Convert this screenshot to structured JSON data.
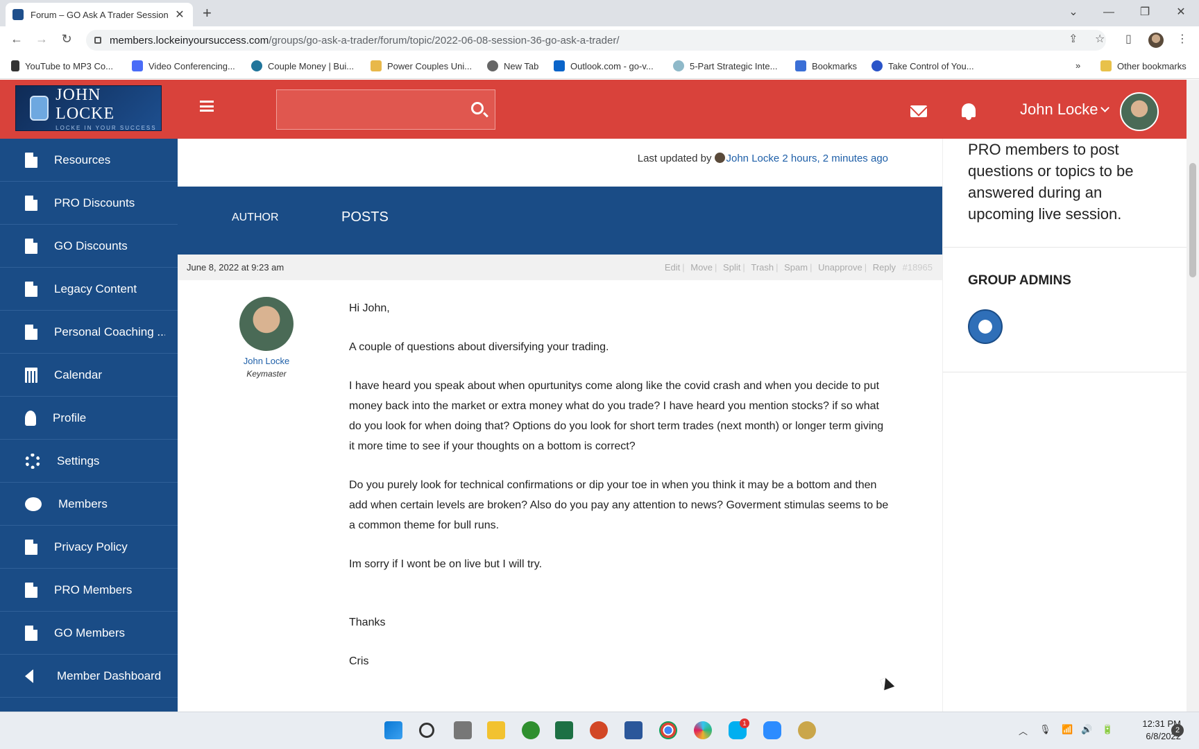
{
  "browser": {
    "tab_title": "Forum – GO Ask A Trader Session",
    "url_domain": "members.lockeinyoursuccess.com",
    "url_path": "/groups/go-ask-a-trader/forum/topic/2022-06-08-session-36-go-ask-a-trader/",
    "bookmarks": [
      "YouTube to MP3 Co...",
      "Video Conferencing...",
      "Couple Money | Bui...",
      "Power Couples Uni...",
      "New Tab",
      "Outlook.com - go-v...",
      "5-Part Strategic Inte...",
      "Bookmarks",
      "Take Control of You..."
    ],
    "bookmarks_more": "»",
    "other_bookmarks": "Other bookmarks"
  },
  "header": {
    "logo_title": "JOHN LOCKE",
    "logo_subtitle": "LOCKE IN YOUR SUCCESS",
    "search_placeholder": "",
    "user_name": "John Locke"
  },
  "sidebar": {
    "items": [
      {
        "label": "Resources",
        "icon": "document-icon"
      },
      {
        "label": "PRO Discounts",
        "icon": "document-icon"
      },
      {
        "label": "GO Discounts",
        "icon": "document-icon"
      },
      {
        "label": "Legacy Content",
        "icon": "document-icon"
      },
      {
        "label": "Personal Coaching ...",
        "icon": "document-icon"
      },
      {
        "label": "Calendar",
        "icon": "calendar-icon"
      },
      {
        "label": "Profile",
        "icon": "user-icon"
      },
      {
        "label": "Settings",
        "icon": "gear-icon"
      },
      {
        "label": "Members",
        "icon": "users-icon"
      },
      {
        "label": "Privacy Policy",
        "icon": "document-icon"
      },
      {
        "label": "PRO Members",
        "icon": "document-icon"
      },
      {
        "label": "GO Members",
        "icon": "document-icon"
      },
      {
        "label": "Member Dashboard",
        "icon": "reply-icon"
      }
    ]
  },
  "main": {
    "updated_prefix": "Last updated by",
    "updated_by": "John Locke",
    "updated_time": "2 hours, 2 minutes ago",
    "col_author": "AUTHOR",
    "col_posts": "POSTS",
    "post": {
      "date": "June 8, 2022 at 9:23 am",
      "actions": [
        "Edit",
        "Move",
        "Split",
        "Trash",
        "Spam",
        "Unapprove",
        "Reply"
      ],
      "post_id": "#18965",
      "author_name": "John Locke",
      "author_role": "Keymaster",
      "paragraphs": [
        "Hi John,",
        "A couple of  questions about diversifying your trading.",
        "I have heard you speak about when opurtunitys come along like the covid crash and when you decide to put money back into the market or extra money what do you trade?  I have heard you mention stocks? if so what do you look for when doing that? Options do you look for short term trades (next month) or longer term giving it more time to see if your thoughts on a bottom is correct?",
        "Do you purely look for technical confirmations or dip your toe in when you think it may be a bottom and then add when certain levels are broken? Also do you pay any attention to news?  Goverment stimulas seems to be a common theme for bull runs.",
        "Im sorry if I wont be on live but I will try.",
        "Thanks",
        "Cris"
      ]
    }
  },
  "right": {
    "widget_text": "PRO members to post questions or topics to be answered during an upcoming live session.",
    "admins_title": "GROUP ADMINS"
  },
  "taskbar": {
    "time": "12:31 PM",
    "date": "6/8/2022",
    "notifications": "2",
    "skype_badge": "1"
  },
  "colors": {
    "header_red": "#d9423b",
    "sidebar_blue": "#1a4c86",
    "link_blue": "#1e5fa8"
  }
}
